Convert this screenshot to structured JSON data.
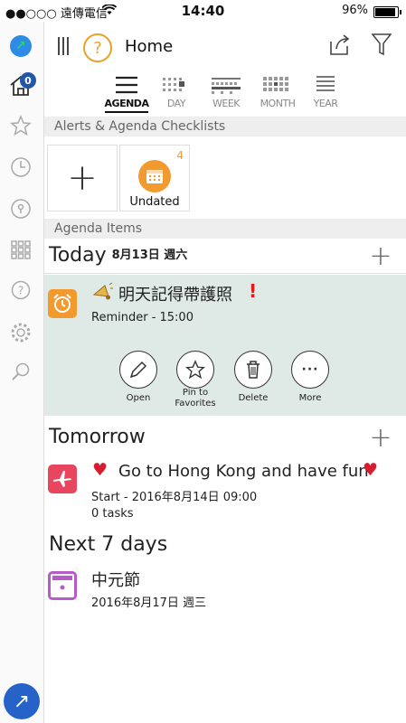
{
  "status_bar": {
    "carrier": "●●○○○ 遠傳電信",
    "time": "14:40",
    "battery": "96%"
  },
  "sidebar": {
    "home_badge": "0"
  },
  "navbar": {
    "title": "Home",
    "help": "?"
  },
  "view_tabs": [
    {
      "label": "AGENDA",
      "active": true
    },
    {
      "label": "DAY"
    },
    {
      "label": "WEEK"
    },
    {
      "label": "MONTH"
    },
    {
      "label": "YEAR"
    }
  ],
  "sections": {
    "checklists": "Alerts & Agenda Checklists",
    "agenda_items": "Agenda Items"
  },
  "checklists": {
    "undated_label": "Undated",
    "undated_count": "4"
  },
  "days": {
    "today": {
      "label": "Today",
      "date": "8月13日 週六"
    },
    "tomorrow": {
      "label": "Tomorrow"
    },
    "next7": {
      "label": "Next 7 days"
    }
  },
  "items": {
    "reminder": {
      "title": "明天記得帶護照",
      "sub": "Reminder - 15:00"
    },
    "trip": {
      "title": "Go to Hong Kong and have fun",
      "sub": "Start - 2016年8月14日 09:00",
      "tasks": "0 tasks"
    },
    "festival": {
      "title": "中元節",
      "sub": "2016年8月17日 週三"
    }
  },
  "actions": {
    "open": "Open",
    "pin_line1": "Pin to",
    "pin_line2": "Favorites",
    "delete": "Delete",
    "more": "More"
  },
  "colors": {
    "accent_orange": "#f29a2e",
    "selected_bg": "#dfe9e6",
    "alarm_icon": "#f29a2e",
    "plane_icon": "#e8455f",
    "calendar_icon": "#b65bc8",
    "brand_blue": "#2563c8"
  }
}
